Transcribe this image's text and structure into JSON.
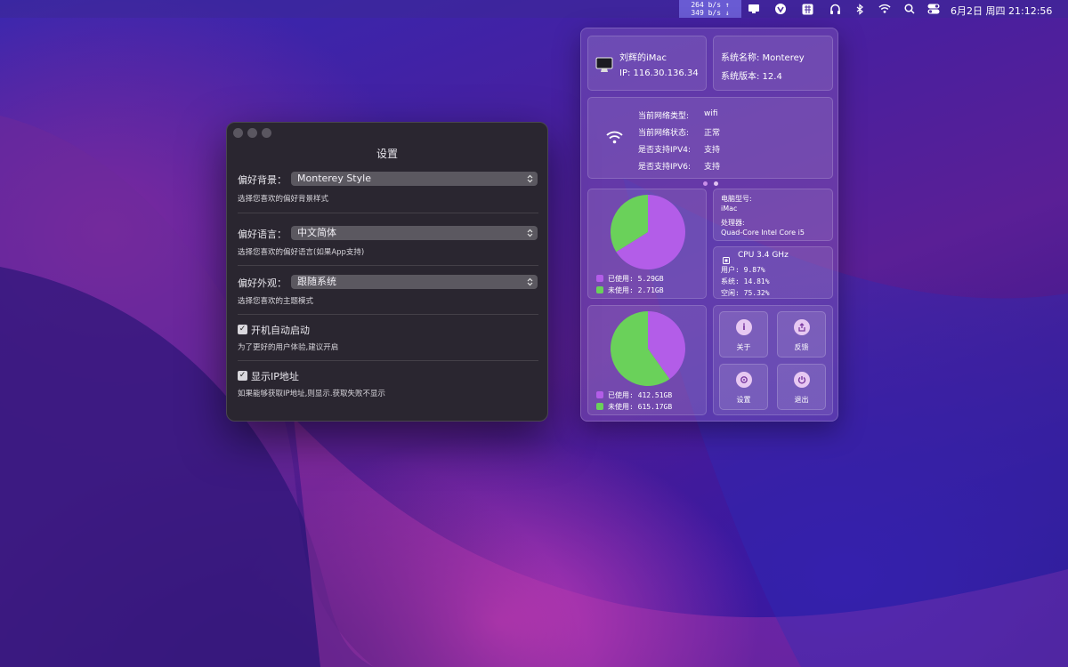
{
  "menubar": {
    "net_up": "264 b/s ↑",
    "net_down": "349 b/s ↓",
    "clock": "6月2日 周四  21:12:56"
  },
  "settings": {
    "title": "设置",
    "background_label": "偏好背景：",
    "background_value": "Monterey Style",
    "background_hint": "选择您喜欢的偏好背景样式",
    "language_label": "偏好语言：",
    "language_value": "中文简体",
    "language_hint": "选择您喜欢的偏好语言(如果App支持)",
    "appearance_label": "偏好外观：",
    "appearance_value": "跟随系统",
    "appearance_hint": "选择您喜欢的主题模式",
    "autostart_label": "开机自动启动",
    "autostart_hint": "为了更好的用户体验,建议开启",
    "showip_label": "显示IP地址",
    "showip_hint": "如果能够获取IP地址,则显示.获取失败不显示"
  },
  "panel": {
    "device_name": "刘辉的iMac",
    "ip": "IP: 116.30.136.34",
    "system_name": "系统名称: Monterey",
    "system_version": "系统版本: 12.4",
    "network": {
      "type_label": "当前网络类型:",
      "type_value": "wifi",
      "status_label": "当前网络状态:",
      "status_value": "正常",
      "ipv4_label": "是否支持IPV4:",
      "ipv4_value": "支持",
      "ipv6_label": "是否支持IPV6:",
      "ipv6_value": "支持"
    },
    "memory": {
      "used_label": "已使用: 5.29GB",
      "free_label": "未使用: 2.71GB",
      "used": 5.29,
      "free": 2.71
    },
    "disk": {
      "used_label": "已使用: 412.51GB",
      "free_label": "未使用: 615.17GB",
      "used": 412.51,
      "free": 615.17
    },
    "model_label": "电脑型号:",
    "model_value": "iMac",
    "cpu_label": "处理器:",
    "cpu_value": "Quad-Core Intel Core i5",
    "cpu_title": "CPU  3.4 GHz",
    "cpu_user": "用户:  9.87%",
    "cpu_system": "系统:  14.81%",
    "cpu_idle": "空闲:  75.32%",
    "buttons": {
      "about": "关于",
      "feedback": "反馈",
      "settings": "设置",
      "quit": "退出"
    }
  },
  "colors": {
    "used": "#b35de8",
    "free": "#6ad15a"
  }
}
